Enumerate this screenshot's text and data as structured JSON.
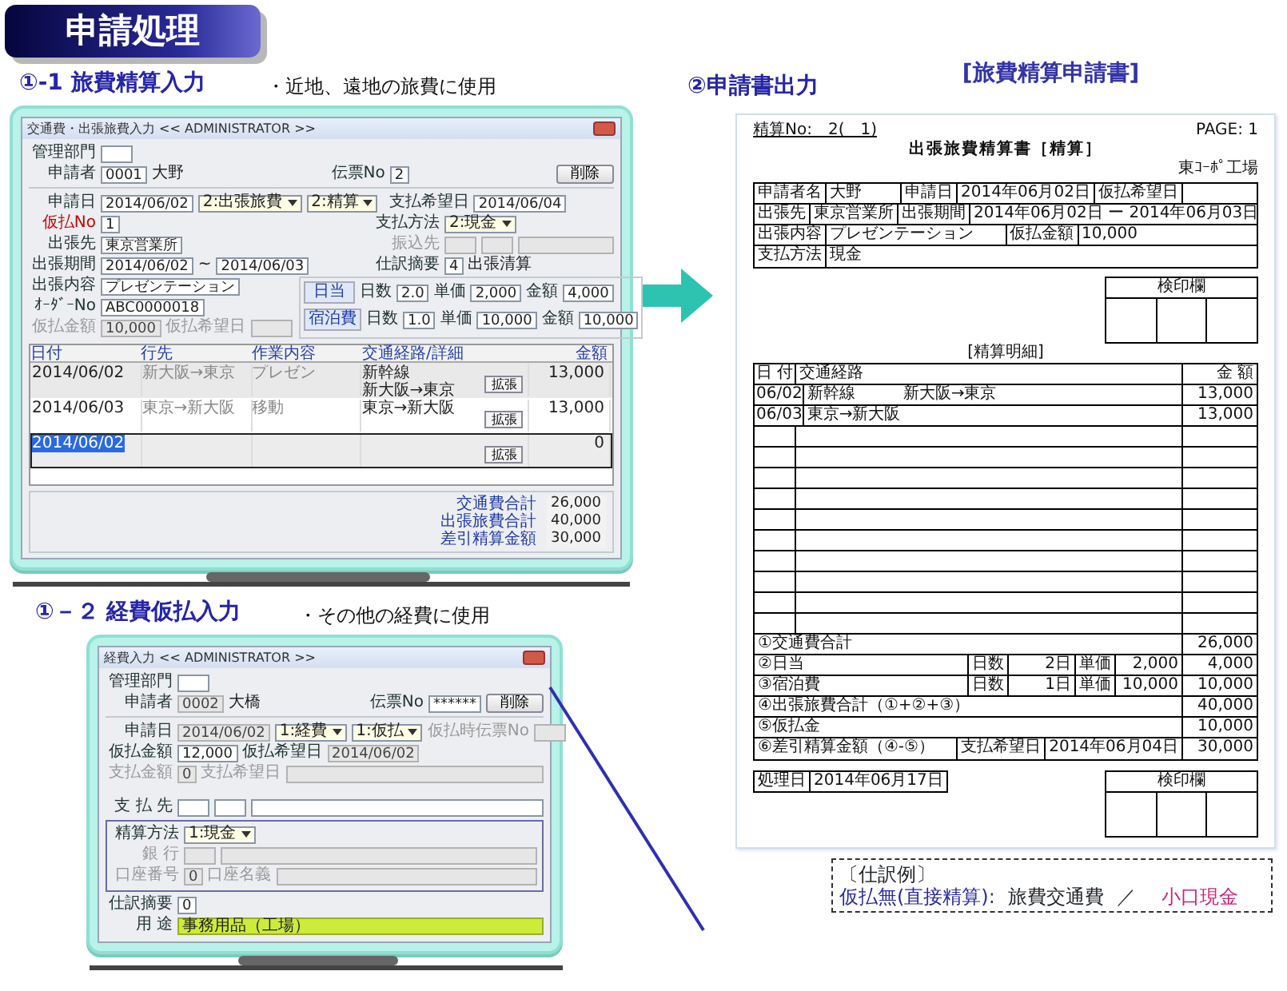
{
  "banner": {
    "title": "申請処理"
  },
  "travel": {
    "heading": "①-1 旅費精算入力",
    "note": "・近地、遠地の旅費に使用",
    "window": {
      "title": "交通費・出張旅費入力 << ADMINISTRATOR >>",
      "top_rows": [
        [
          {
            "kind": "label",
            "text": "管理部門"
          },
          {
            "kind": "field"
          }
        ],
        [
          {
            "kind": "label",
            "text": "申請者"
          },
          {
            "kind": "field",
            "value": "0001"
          },
          {
            "kind": "text",
            "text": "大野"
          },
          {
            "kind": "gap"
          },
          {
            "kind": "label",
            "text": "伝票No"
          },
          {
            "kind": "field",
            "value": "2"
          },
          {
            "kind": "gap"
          },
          {
            "kind": "button",
            "text": "削除"
          }
        ]
      ],
      "split_rows": [
        {
          "left": [
            {
              "kind": "label",
              "text": "申請日"
            },
            {
              "kind": "field",
              "value": "2014/06/02"
            },
            {
              "kind": "select",
              "value": "2:出張旅費"
            },
            {
              "kind": "select",
              "value": "2:精算"
            }
          ],
          "right": [
            {
              "kind": "label",
              "text": "支払希望日"
            },
            {
              "kind": "field",
              "value": "2014/06/04"
            }
          ]
        },
        {
          "left": [
            {
              "kind": "label-red",
              "text": "仮払No"
            },
            {
              "kind": "field",
              "value": "1"
            }
          ],
          "right": [
            {
              "kind": "label",
              "text": "支払方法"
            },
            {
              "kind": "select",
              "value": "2:現金"
            }
          ]
        },
        {
          "left": [
            {
              "kind": "label",
              "text": "出張先"
            },
            {
              "kind": "field",
              "value": "東京営業所"
            }
          ],
          "right": [
            {
              "kind": "label-dim",
              "text": "振込先"
            },
            {
              "kind": "field-dim"
            },
            {
              "kind": "field-dim"
            },
            {
              "kind": "field-dim"
            }
          ]
        },
        {
          "left": [
            {
              "kind": "label",
              "text": "出張期間"
            },
            {
              "kind": "field",
              "value": "2014/06/02"
            },
            {
              "kind": "text",
              "text": "~"
            },
            {
              "kind": "field",
              "value": "2014/06/03"
            }
          ],
          "right": [
            {
              "kind": "label",
              "text": "仕訳摘要"
            },
            {
              "kind": "field",
              "value": "4"
            },
            {
              "kind": "text",
              "text": "出張清算"
            }
          ]
        }
      ],
      "lower_rows": [
        [
          {
            "kind": "label",
            "text": "出張内容"
          },
          {
            "kind": "field",
            "value": "プレゼンテーション"
          }
        ],
        [
          {
            "kind": "label",
            "text": "ｵｰﾀﾞｰNo"
          },
          {
            "kind": "field",
            "value": "ABC0000018"
          }
        ],
        [
          {
            "kind": "label-dim",
            "text": "仮払金額"
          },
          {
            "kind": "field-dim",
            "value": "10,000"
          },
          {
            "kind": "label-dim",
            "text": "仮払希望日"
          },
          {
            "kind": "field-dim"
          }
        ]
      ],
      "allowances": [
        [
          {
            "kind": "tag",
            "text": "日当"
          },
          {
            "kind": "label",
            "text": "日数"
          },
          {
            "kind": "field",
            "value": "2.0"
          },
          {
            "kind": "label",
            "text": "単価"
          },
          {
            "kind": "field",
            "value": "2,000"
          },
          {
            "kind": "label",
            "text": "金額"
          },
          {
            "kind": "field",
            "value": "4,000"
          }
        ],
        [
          {
            "kind": "tag",
            "text": "宿泊費"
          },
          {
            "kind": "label",
            "text": "日数"
          },
          {
            "kind": "field",
            "value": "1.0"
          },
          {
            "kind": "label",
            "text": "単価"
          },
          {
            "kind": "field",
            "value": "10,000"
          },
          {
            "kind": "label",
            "text": "金額"
          },
          {
            "kind": "field",
            "value": "10,000"
          }
        ]
      ],
      "table": {
        "columns": [
          "日付",
          "行先",
          "作業内容",
          "交通経路/詳細",
          "金額"
        ],
        "rows": [
          {
            "date": "2014/06/02",
            "destination": "新大阪→東京",
            "work": "プレゼン",
            "route": [
              "新幹線",
              "新大阪→東京"
            ],
            "amount": "13,000",
            "button": "拡張",
            "selected": false
          },
          {
            "date": "2014/06/03",
            "destination": "東京→新大阪",
            "work": "移動",
            "route": [
              "東京→新大阪"
            ],
            "amount": "13,000",
            "button": "拡張",
            "selected": false
          },
          {
            "date": "2014/06/02",
            "route": [],
            "amount": "0",
            "button": "拡張",
            "selected": true
          }
        ]
      },
      "totals": [
        {
          "label": "交通費合計",
          "value": "26,000"
        },
        {
          "label": "出張旅費合計",
          "value": "40,000"
        },
        {
          "label": "差引精算金額",
          "value": "30,000"
        }
      ]
    }
  },
  "expense": {
    "heading": "①－２ 経費仮払入力",
    "note": "・その他の経費に使用",
    "window": {
      "title": "経費入力 << ADMINISTRATOR >>",
      "blocks": [
        {
          "kind": "row",
          "items": [
            {
              "kind": "label",
              "text": "管理部門"
            },
            {
              "kind": "field"
            }
          ]
        },
        {
          "kind": "row",
          "items": [
            {
              "kind": "label",
              "text": "申請者"
            },
            {
              "kind": "field-dim",
              "value": "0002"
            },
            {
              "kind": "text",
              "text": "大橋"
            },
            {
              "kind": "gap"
            },
            {
              "kind": "label",
              "text": "伝票No"
            },
            {
              "kind": "field",
              "value": "******"
            },
            {
              "kind": "button",
              "text": "削除"
            }
          ]
        },
        {
          "kind": "rule"
        },
        {
          "kind": "row",
          "items": [
            {
              "kind": "label",
              "text": "申請日"
            },
            {
              "kind": "field-dim",
              "value": "2014/06/02"
            },
            {
              "kind": "select",
              "value": "1:経費"
            },
            {
              "kind": "select",
              "value": "1:仮払"
            },
            {
              "kind": "label-dim",
              "text": "仮払時伝票No"
            },
            {
              "kind": "field-dim"
            }
          ]
        },
        {
          "kind": "row",
          "items": [
            {
              "kind": "label",
              "text": "仮払金額"
            },
            {
              "kind": "field",
              "value": "12,000"
            },
            {
              "kind": "label",
              "text": "仮払希望日"
            },
            {
              "kind": "field-dim",
              "value": "2014/06/02"
            }
          ]
        },
        {
          "kind": "row",
          "items": [
            {
              "kind": "label-dim",
              "text": "支払金額"
            },
            {
              "kind": "field-dim",
              "value": "0"
            },
            {
              "kind": "label-dim",
              "text": "支払希望日"
            },
            {
              "kind": "field-dim"
            }
          ]
        },
        {
          "kind": "spacer"
        },
        {
          "kind": "row",
          "items": [
            {
              "kind": "label",
              "text": "支 払 先"
            },
            {
              "kind": "field"
            },
            {
              "kind": "field"
            },
            {
              "kind": "field"
            }
          ]
        },
        {
          "kind": "group",
          "rows": [
            [
              {
                "kind": "label",
                "text": "精算方法"
              },
              {
                "kind": "select",
                "value": "1:現金"
              }
            ],
            [
              {
                "kind": "label-dim",
                "text": "銀 行"
              },
              {
                "kind": "field-dim"
              },
              {
                "kind": "field-dim"
              }
            ],
            [
              {
                "kind": "label-dim",
                "text": "口座番号"
              },
              {
                "kind": "field-dim",
                "value": "0"
              },
              {
                "kind": "label-dim",
                "text": "口座名義"
              },
              {
                "kind": "field-dim"
              }
            ]
          ]
        },
        {
          "kind": "row",
          "items": [
            {
              "kind": "label",
              "text": "仕訳摘要"
            },
            {
              "kind": "field",
              "value": "0"
            }
          ]
        },
        {
          "kind": "row",
          "items": [
            {
              "kind": "label",
              "text": "用 途"
            },
            {
              "kind": "field-hl",
              "value": "事務用品（工場）"
            }
          ]
        }
      ]
    }
  },
  "output": {
    "heading": "②申請書出力",
    "doc_title": "[旅費精算申請書]",
    "document": {
      "number": "精算No:　2(　1)",
      "page": "PAGE: 1",
      "title": "出張旅費精算書［精算］",
      "company": "東ｺｰﾎﾟ工場",
      "info": [
        [
          {
            "kind": "head",
            "text": "申請者名"
          },
          {
            "kind": "value",
            "text": "大野"
          },
          {
            "kind": "head",
            "text": "申請日"
          },
          {
            "kind": "value",
            "text": "2014年06月02日"
          },
          {
            "kind": "head",
            "text": "仮払希望日"
          },
          {
            "kind": "value"
          }
        ],
        [
          {
            "kind": "head",
            "text": "出張先"
          },
          {
            "kind": "value",
            "text": "東京営業所"
          },
          {
            "kind": "head",
            "text": "出張期間"
          },
          {
            "kind": "value",
            "text": "2014年06月02日 ー 2014年06月03日"
          }
        ],
        [
          {
            "kind": "head",
            "text": "出張内容"
          },
          {
            "kind": "value",
            "text": "プレゼンテーション"
          },
          {
            "kind": "head",
            "text": "仮払金額"
          },
          {
            "kind": "value",
            "text": "10,000"
          }
        ],
        [
          {
            "kind": "head",
            "text": "支払方法"
          },
          {
            "kind": "value",
            "text": "現金"
          }
        ]
      ],
      "stamp_top": "検印欄",
      "detail_title": "[精算明細]",
      "detail_columns": [
        "日 付",
        "交通経路",
        "金 額"
      ],
      "detail_rows": [
        {
          "date": "06/02",
          "route": "新幹線",
          "section": "新大阪→東京",
          "amount": "13,000"
        },
        {
          "date": "06/03",
          "route": "東京→新大阪",
          "amount": "13,000"
        }
      ],
      "summary": [
        [
          {
            "kind": "label",
            "text": "①交通費合計"
          },
          {
            "kind": "amount",
            "text": "26,000"
          }
        ],
        [
          {
            "kind": "label",
            "text": "②日当"
          },
          {
            "kind": "key",
            "text": "日数"
          },
          {
            "kind": "value",
            "text": "2日"
          },
          {
            "kind": "key",
            "text": "単価"
          },
          {
            "kind": "value",
            "text": "2,000"
          },
          {
            "kind": "amount",
            "text": "4,000"
          }
        ],
        [
          {
            "kind": "label",
            "text": "③宿泊費"
          },
          {
            "kind": "key",
            "text": "日数"
          },
          {
            "kind": "value",
            "text": "1日"
          },
          {
            "kind": "key",
            "text": "単価"
          },
          {
            "kind": "value",
            "text": "10,000"
          },
          {
            "kind": "amount",
            "text": "10,000"
          }
        ],
        [
          {
            "kind": "label",
            "text": "④出張旅費合計（①+②+③）"
          },
          {
            "kind": "amount",
            "text": "40,000"
          }
        ],
        [
          {
            "kind": "label",
            "text": "⑤仮払金"
          },
          {
            "kind": "amount",
            "text": "10,000"
          }
        ],
        [
          {
            "kind": "label",
            "text": "⑥差引精算金額（④-⑤）"
          },
          {
            "kind": "wkey",
            "text": "支払希望日"
          },
          {
            "kind": "wvalue",
            "text": "2014年06月04日"
          },
          {
            "kind": "amount",
            "text": "30,000"
          }
        ]
      ],
      "processed_label": "処理日",
      "processed_value": "2014年06月17日",
      "stamp_bottom": "検印欄"
    },
    "journal_note": {
      "title": "〔仕訳例〕",
      "parts": [
        {
          "kind": "condition",
          "text": "仮払無(直接精算):"
        },
        {
          "kind": "debit",
          "text": "旅費交通費"
        },
        {
          "kind": "separator",
          "text": "／"
        },
        {
          "kind": "credit",
          "text": "小口現金"
        }
      ]
    }
  }
}
